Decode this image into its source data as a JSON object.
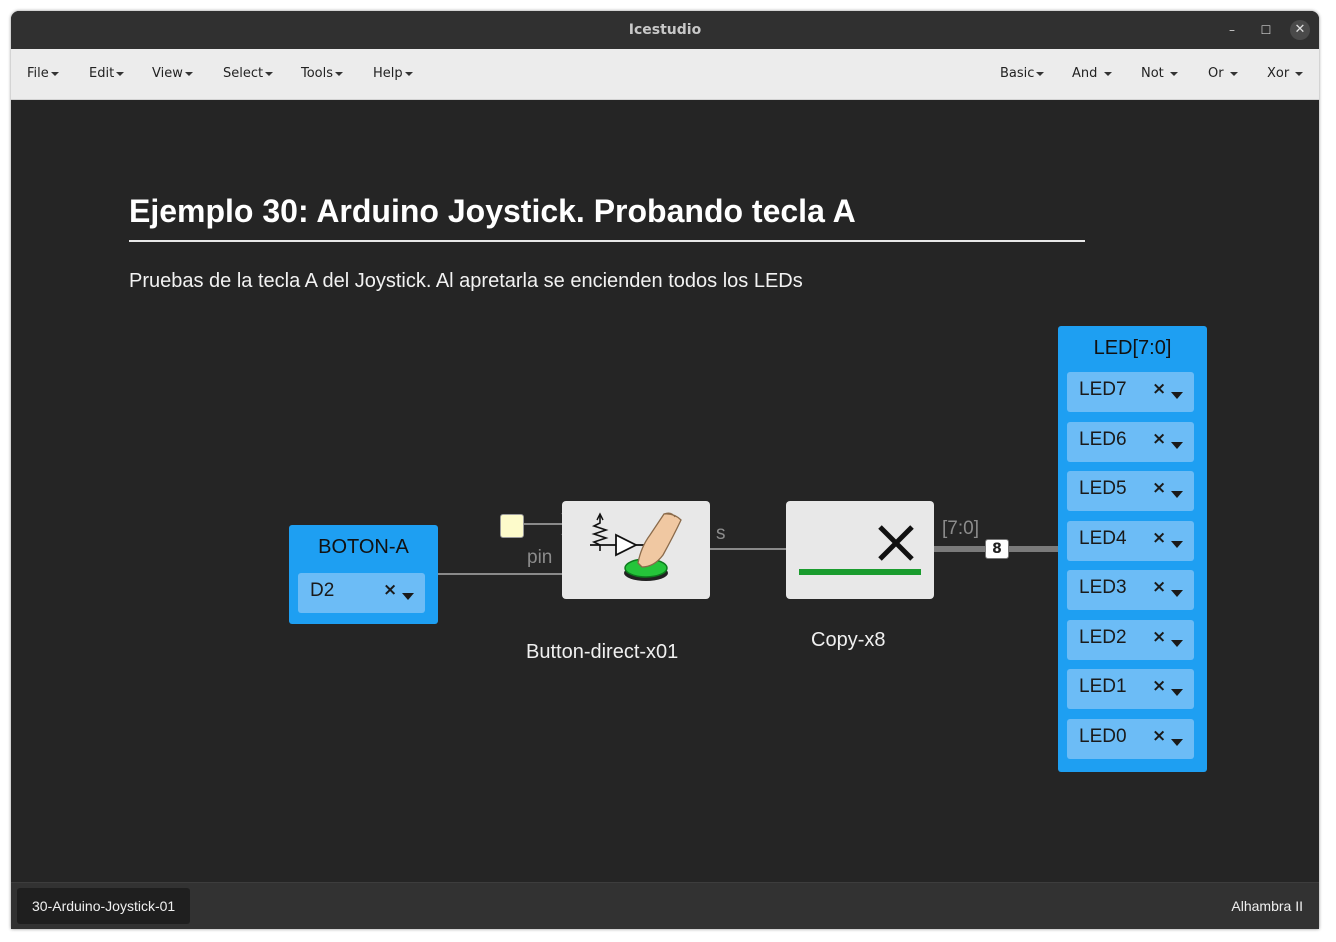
{
  "window": {
    "title": "Icestudio",
    "controls": {
      "minimize": "–",
      "maximize": "☐",
      "close": "✕"
    }
  },
  "menubar": {
    "left": [
      "File",
      "Edit",
      "View",
      "Select",
      "Tools",
      "Help"
    ],
    "right": [
      "Basic",
      "And",
      "Not",
      "Or",
      "Xor"
    ]
  },
  "canvas": {
    "heading": "Ejemplo 30: Arduino Joystick. Probando tecla A",
    "description": "Pruebas de la tecla A del Joystick. Al apretarla se encienden todos los LEDs",
    "input_block": {
      "name": "BOTON-A",
      "pin": "D2",
      "clear": "×"
    },
    "button_module": {
      "label": "Button-direct-x01",
      "in_port": "pin",
      "out_port": "s"
    },
    "copy_module": {
      "label": "Copy-x8"
    },
    "bus": {
      "range_label": "[7:0]",
      "width": "8"
    },
    "output_block": {
      "name": "LED[7:0]",
      "pins": [
        "LED7",
        "LED6",
        "LED5",
        "LED4",
        "LED3",
        "LED2",
        "LED1",
        "LED0"
      ],
      "clear": "×"
    }
  },
  "colors": {
    "block": "#1e9ff2",
    "select": "#6cbcf6",
    "canvas": "#252525",
    "green": "#1a9c2e"
  },
  "statusbar": {
    "tab": "30-Arduino-Joystick-01",
    "board": "Alhambra II"
  }
}
